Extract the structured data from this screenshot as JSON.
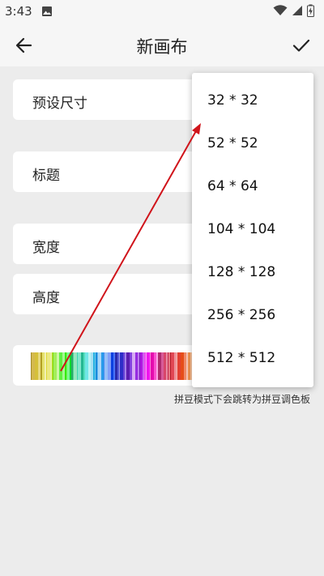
{
  "status_bar": {
    "time": "3:43"
  },
  "app_bar": {
    "title": "新画布",
    "back_icon": "arrow-left-icon",
    "confirm_icon": "check-icon"
  },
  "fields": {
    "preset_size_label": "预设尺寸",
    "title_label": "标题",
    "width_label": "宽度",
    "height_label": "高度"
  },
  "hint": "拼豆模式下会跳转为拼豆调色板",
  "size_menu": {
    "options": [
      "32 * 32",
      "52 * 52",
      "64 * 64",
      "104 * 104",
      "128 * 128",
      "256 * 256",
      "512 * 512"
    ]
  },
  "colors": {
    "background": "#ececec",
    "card": "#ffffff",
    "annotation_arrow": "#d0141b"
  }
}
